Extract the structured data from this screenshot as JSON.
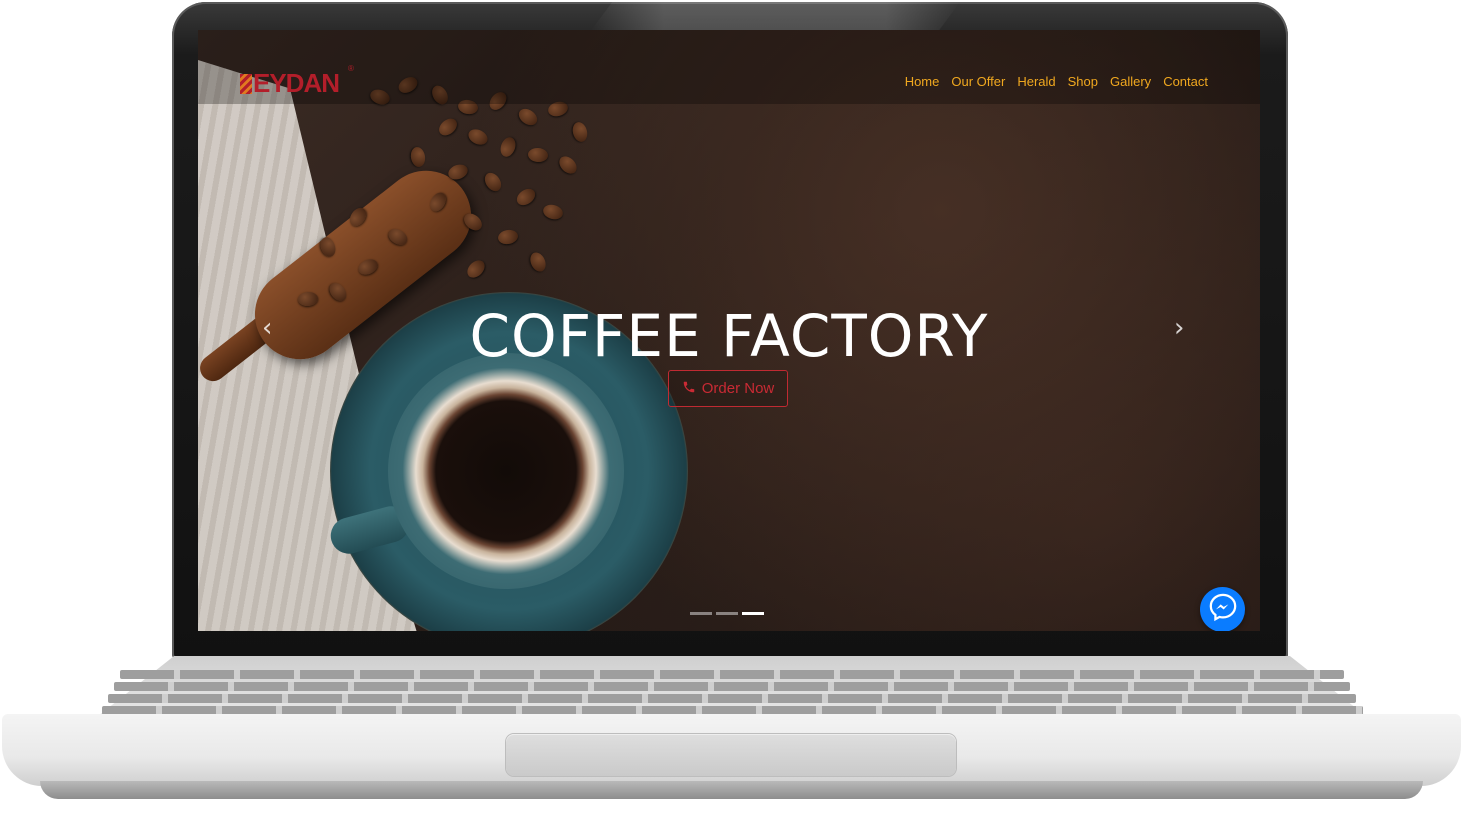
{
  "brand": {
    "logo_text": "EYDAN",
    "logo_mark": "®",
    "color": "#b31e2a"
  },
  "nav": {
    "items": [
      "Home",
      "Our Offer",
      "Herald",
      "Shop",
      "Gallery",
      "Contact"
    ],
    "color": "#f0a81f"
  },
  "hero": {
    "title": "COFFEE FACTORY",
    "cta_label": "Order Now",
    "cta_icon": "phone-icon",
    "cta_color": "#c92a34",
    "prev_icon": "chevron-left-icon",
    "next_icon": "chevron-right-icon",
    "slides_count": 3,
    "active_slide": 3
  },
  "chat_widget": {
    "icon": "messenger-icon",
    "color": "#0a7cff"
  }
}
